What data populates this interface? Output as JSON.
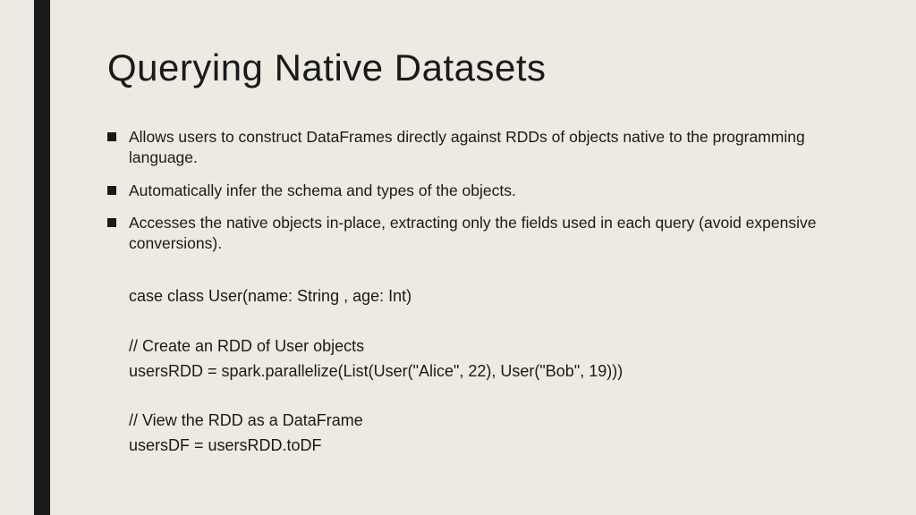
{
  "title": "Querying Native Datasets",
  "bullets": [
    "Allows users to construct DataFrames directly against RDDs of objects native to the programming language.",
    "Automatically infer the schema and types of the objects.",
    "Accesses the native objects in-place, extracting only the fields used in each query (avoid expensive conversions)."
  ],
  "code": {
    "line1": "case class User(name: String , age: Int)",
    "line2": "// Create an RDD of User objects",
    "line3": "usersRDD = spark.parallelize(List(User(\"Alice\", 22), User(\"Bob\", 19)))",
    "line4": "// View the RDD as a DataFrame",
    "line5": "usersDF = usersRDD.toDF"
  }
}
